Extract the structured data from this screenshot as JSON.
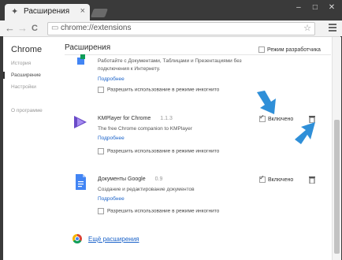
{
  "tab": {
    "title": "Расширения",
    "close": "×"
  },
  "window": {
    "minimize": "–",
    "maximize": "□",
    "close": "✕"
  },
  "toolbar": {
    "back": "←",
    "forward": "→",
    "reload": "C",
    "url": "chrome://extensions",
    "star": "☆"
  },
  "sidebar": {
    "brand": "Chrome",
    "items": [
      {
        "label": "История"
      },
      {
        "label": "Расширение"
      },
      {
        "label": "Настройки"
      },
      {
        "label": "О программе"
      }
    ]
  },
  "page": {
    "title": "Расширения",
    "dev_mode_label": "Режим разработчика",
    "more_extensions": "Ещё расширения"
  },
  "extensions": [
    {
      "name": "",
      "version": "",
      "desc_line1": "Работайте с Документами, Таблицами и Презентациями без",
      "desc_line2": "подключения к Интернету.",
      "details": "Подробнее",
      "incognito": "Разрешить использование в режиме инкогнито",
      "enabled_label": "",
      "icon": "google-apps-icon"
    },
    {
      "name": "KMPlayer for Chrome",
      "version": "1.1.3",
      "desc_line1": "The free Chrome companion to KMPlayer",
      "details": "Подробнее",
      "incognito": "Разрешить использование в режиме инкогнито",
      "enabled_label": "Включено",
      "icon": "kmplayer-icon"
    },
    {
      "name": "Документы Google",
      "version": "0.9",
      "desc_line1": "Создание и редактирование документов",
      "details": "Подробнее",
      "incognito": "Разрешить использование в режиме инкогнито",
      "enabled_label": "Включено",
      "icon": "google-docs-icon"
    }
  ],
  "colors": {
    "link": "#1a62c9",
    "arrow": "#2f8fd8",
    "frame": "#3a3a3a"
  }
}
